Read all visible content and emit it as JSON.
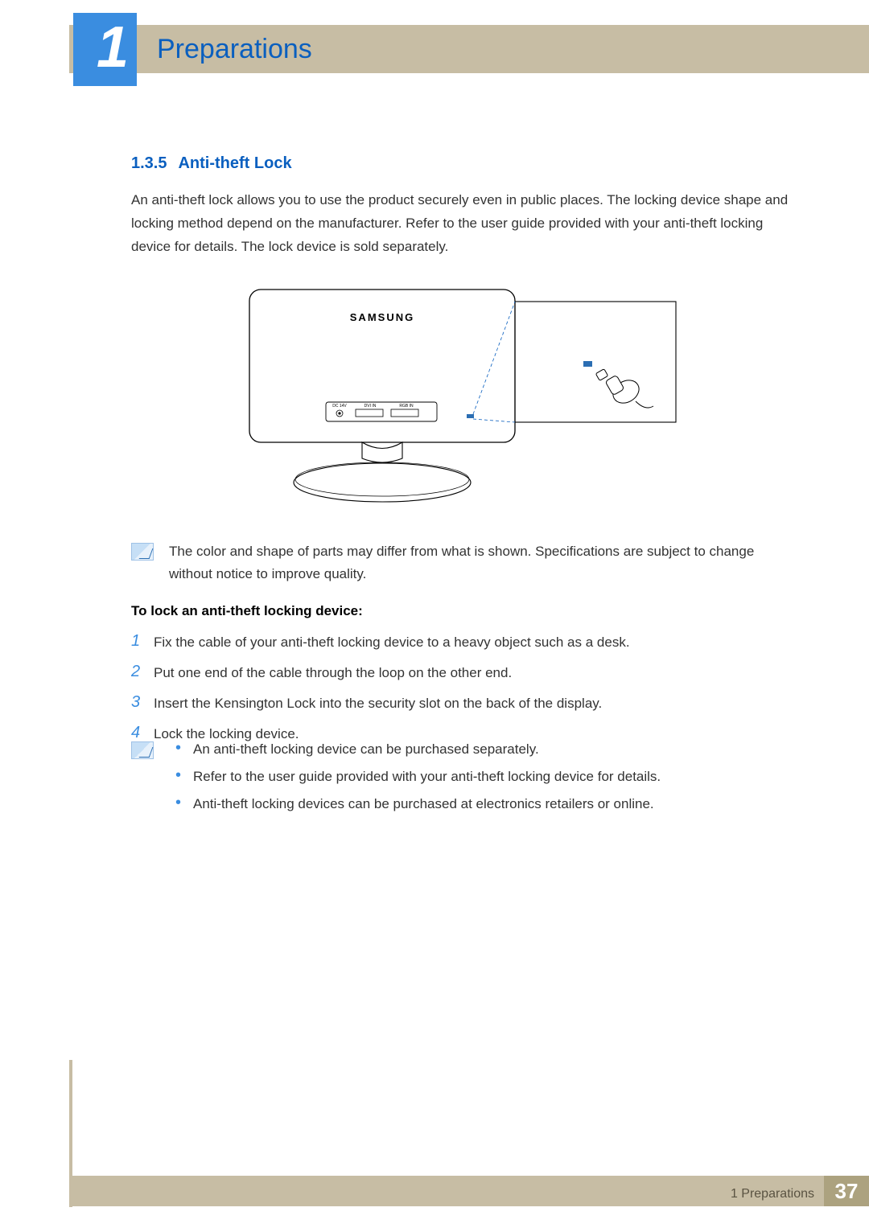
{
  "chapter": {
    "number": "1",
    "title": "Preparations"
  },
  "section": {
    "number": "1.3.5",
    "title": "Anti-theft Lock"
  },
  "intro": "An anti-theft lock allows you to use the product securely even in public places. The locking device shape and locking method depend on the manufacturer. Refer to the user guide provided with your anti-theft locking device for details. The lock device is sold separately.",
  "figure": {
    "brand": "SAMSUNG",
    "ports": [
      "DC 14V",
      "DVI IN",
      "RGB IN"
    ]
  },
  "note1": "The color and shape of parts may differ from what is shown. Specifications are subject to change without notice to improve quality.",
  "subhead": "To lock an anti-theft locking device:",
  "steps": [
    "Fix the cable of your anti-theft locking device to a heavy object such as a desk.",
    "Put one end of the cable through the loop on the other end.",
    "Insert the Kensington Lock into the security slot on the back of the display.",
    "Lock the locking device."
  ],
  "note2": [
    "An anti-theft locking device can be purchased separately.",
    "Refer to the user guide provided with your anti-theft locking device for details.",
    "Anti-theft locking devices can be purchased at electronics retailers or online."
  ],
  "footer": {
    "label": "1 Preparations",
    "page": "37"
  }
}
